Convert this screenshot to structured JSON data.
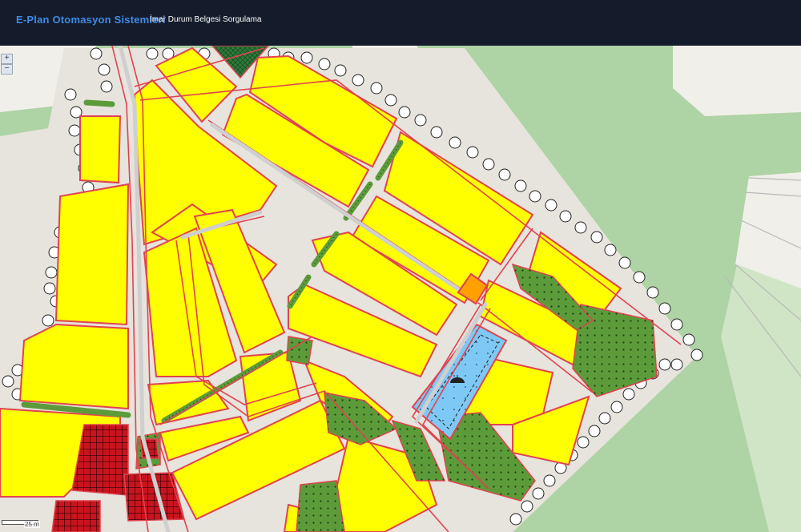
{
  "header": {
    "app_title": "E-Plan Otomasyon Sistemleri",
    "page_title": "İmar Durum Belgesi Sorgulama"
  },
  "map_controls": {
    "zoom_in_symbol": "+",
    "zoom_out_symbol": "−"
  },
  "scale": {
    "label": "25 m"
  },
  "legend_colors": {
    "residential": "#ffff00",
    "selected_parcel": "#ffa000",
    "commercial": "#c8141e",
    "green_area": "#5c9b3a",
    "water_area": "#7ec8f5",
    "road_border": "#e0434f",
    "base_map_green": "#aed3a4"
  },
  "icons": [
    "zoom-in-icon",
    "zoom-out-icon",
    "tree-icon",
    "mosque-icon"
  ]
}
